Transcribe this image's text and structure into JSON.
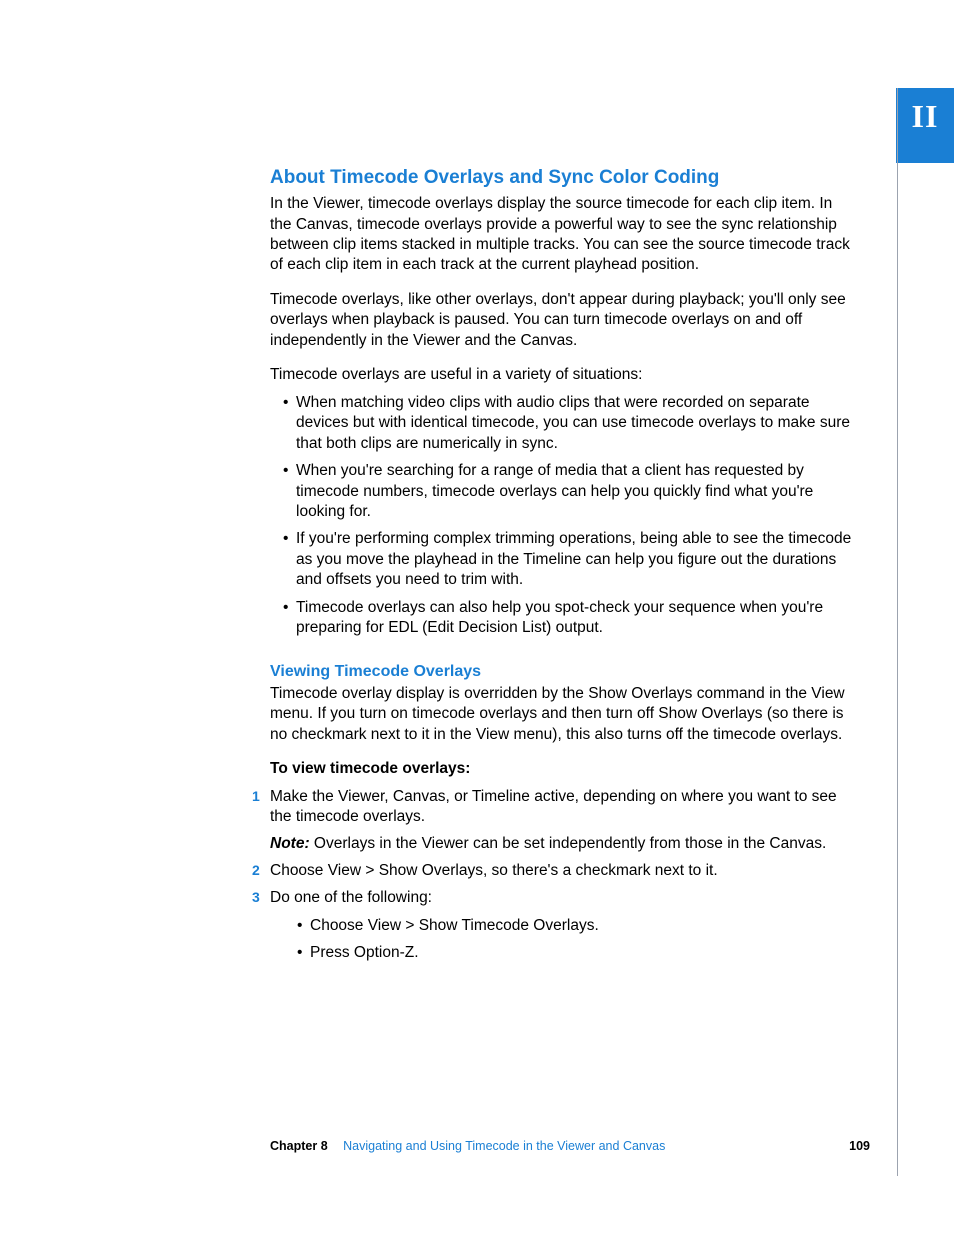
{
  "partLabel": "II",
  "section": {
    "heading": "About Timecode Overlays and Sync Color Coding",
    "para1": "In the Viewer, timecode overlays display the source timecode for each clip item. In the Canvas, timecode overlays provide a powerful way to see the sync relationship between clip items stacked in multiple tracks. You can see the source timecode track of each clip item in each track at the current playhead position.",
    "para2": "Timecode overlays, like other overlays, don't appear during playback; you'll only see overlays when playback is paused. You can turn timecode overlays on and off independently in the Viewer and the Canvas.",
    "para3": "Timecode overlays are useful in a variety of situations:",
    "bullets": [
      "When matching video clips with audio clips that were recorded on separate devices but with identical timecode, you can use timecode overlays to make sure that both clips are numerically in sync.",
      "When you're searching for a range of media that a client has requested by timecode numbers, timecode overlays can help you quickly find what you're looking for.",
      "If you're performing complex trimming operations, being able to see the timecode as you move the playhead in the Timeline can help you figure out the durations and offsets you need to trim with.",
      "Timecode overlays can also help you spot-check your sequence when you're preparing for EDL (Edit Decision List) output."
    ]
  },
  "subsection": {
    "heading": "Viewing Timecode Overlays",
    "para": "Timecode overlay display is overridden by the Show Overlays command in the View menu. If you turn on timecode overlays and then turn off Show Overlays (so there is no checkmark next to it in the View menu), this also turns off the timecode overlays.",
    "procLabel": "To view timecode overlays:",
    "steps": {
      "s1": "Make the Viewer, Canvas, or Timeline active, depending on where you want to see the timecode overlays.",
      "s1noteLabel": "Note:",
      "s1note": "  Overlays in the Viewer can be set independently from those in the Canvas.",
      "s2": "Choose View > Show Overlays, so there's a checkmark next to it.",
      "s3": "Do one of the following:",
      "s3subs": [
        "Choose View > Show Timecode Overlays.",
        "Press Option-Z."
      ]
    }
  },
  "footer": {
    "chapterLabel": "Chapter 8",
    "chapterTitle": "Navigating and Using Timecode in the Viewer and Canvas",
    "pageNumber": "109"
  }
}
